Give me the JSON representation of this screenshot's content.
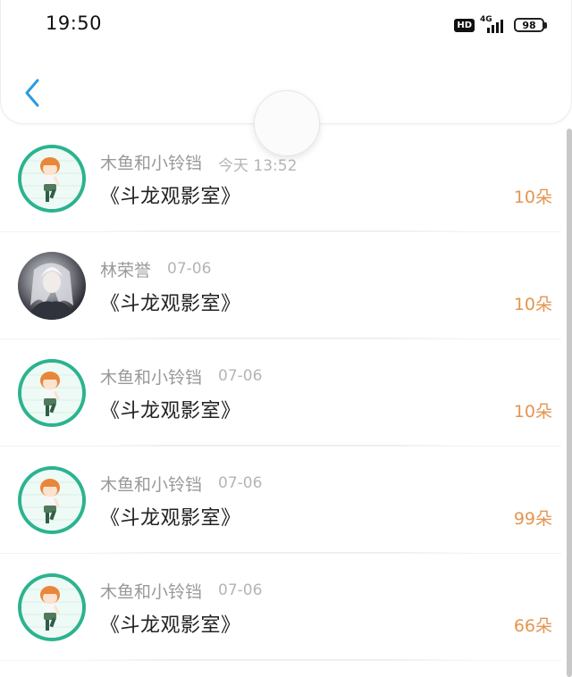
{
  "status_bar": {
    "time": "19:50",
    "hd": "HD",
    "network": "4G",
    "battery": "98"
  },
  "nav": {
    "back_icon": "chevron-left-icon",
    "accent_color": "#2d9be0"
  },
  "list": {
    "items": [
      {
        "name": "木鱼和小铃铛",
        "time": "今天 13:52",
        "title": "《斗龙观影室》",
        "amount": "10朵",
        "avatar": "anime-girl-avatar"
      },
      {
        "name": "林荣誉",
        "time": "07-06",
        "title": "《斗龙观影室》",
        "amount": "10朵",
        "avatar": "dark-haired-avatar"
      },
      {
        "name": "木鱼和小铃铛",
        "time": "07-06",
        "title": "《斗龙观影室》",
        "amount": "10朵",
        "avatar": "anime-girl-avatar"
      },
      {
        "name": "木鱼和小铃铛",
        "time": "07-06",
        "title": "《斗龙观影室》",
        "amount": "99朵",
        "avatar": "anime-girl-avatar"
      },
      {
        "name": "木鱼和小铃铛",
        "time": "07-06",
        "title": "《斗龙观影室》",
        "amount": "66朵",
        "avatar": "anime-girl-avatar"
      }
    ]
  },
  "colors": {
    "amount": "#e39650",
    "name": "#999999",
    "time": "#b5b5b5",
    "title": "#222222"
  }
}
